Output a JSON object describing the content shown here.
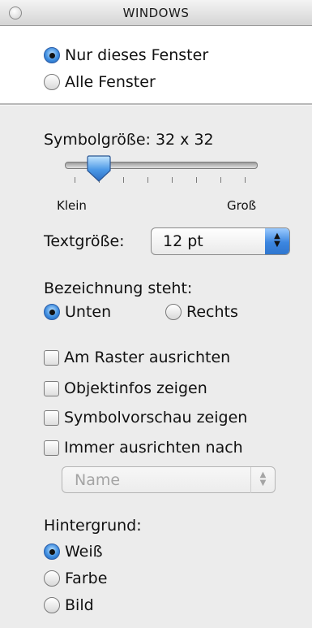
{
  "window": {
    "title": "WINDOWS"
  },
  "scope": {
    "options": [
      {
        "label": "Nur dieses Fenster",
        "selected": true
      },
      {
        "label": "Alle Fenster",
        "selected": false
      }
    ]
  },
  "icon_size": {
    "label": "Symbolgröße: 32 x 32",
    "min_label": "Klein",
    "max_label": "Groß",
    "value_fraction": 0.18
  },
  "text_size": {
    "label": "Textgröße:",
    "value": "12 pt"
  },
  "label_position": {
    "label": "Bezeichnung steht:",
    "options": [
      {
        "label": "Unten",
        "selected": true
      },
      {
        "label": "Rechts",
        "selected": false
      }
    ]
  },
  "checkboxes": [
    {
      "label": "Am Raster ausrichten",
      "checked": false
    },
    {
      "label": "Objektinfos zeigen",
      "checked": false
    },
    {
      "label": "Symbolvorschau zeigen",
      "checked": false
    },
    {
      "label": "Immer ausrichten nach",
      "checked": false
    }
  ],
  "arrange_by": {
    "value": "Name",
    "enabled": false
  },
  "background": {
    "label": "Hintergrund:",
    "options": [
      {
        "label": "Weiß",
        "selected": true
      },
      {
        "label": "Farbe",
        "selected": false
      },
      {
        "label": "Bild",
        "selected": false
      }
    ]
  },
  "colors": {
    "accent": "#3f8ee0",
    "panel": "#ececec"
  }
}
